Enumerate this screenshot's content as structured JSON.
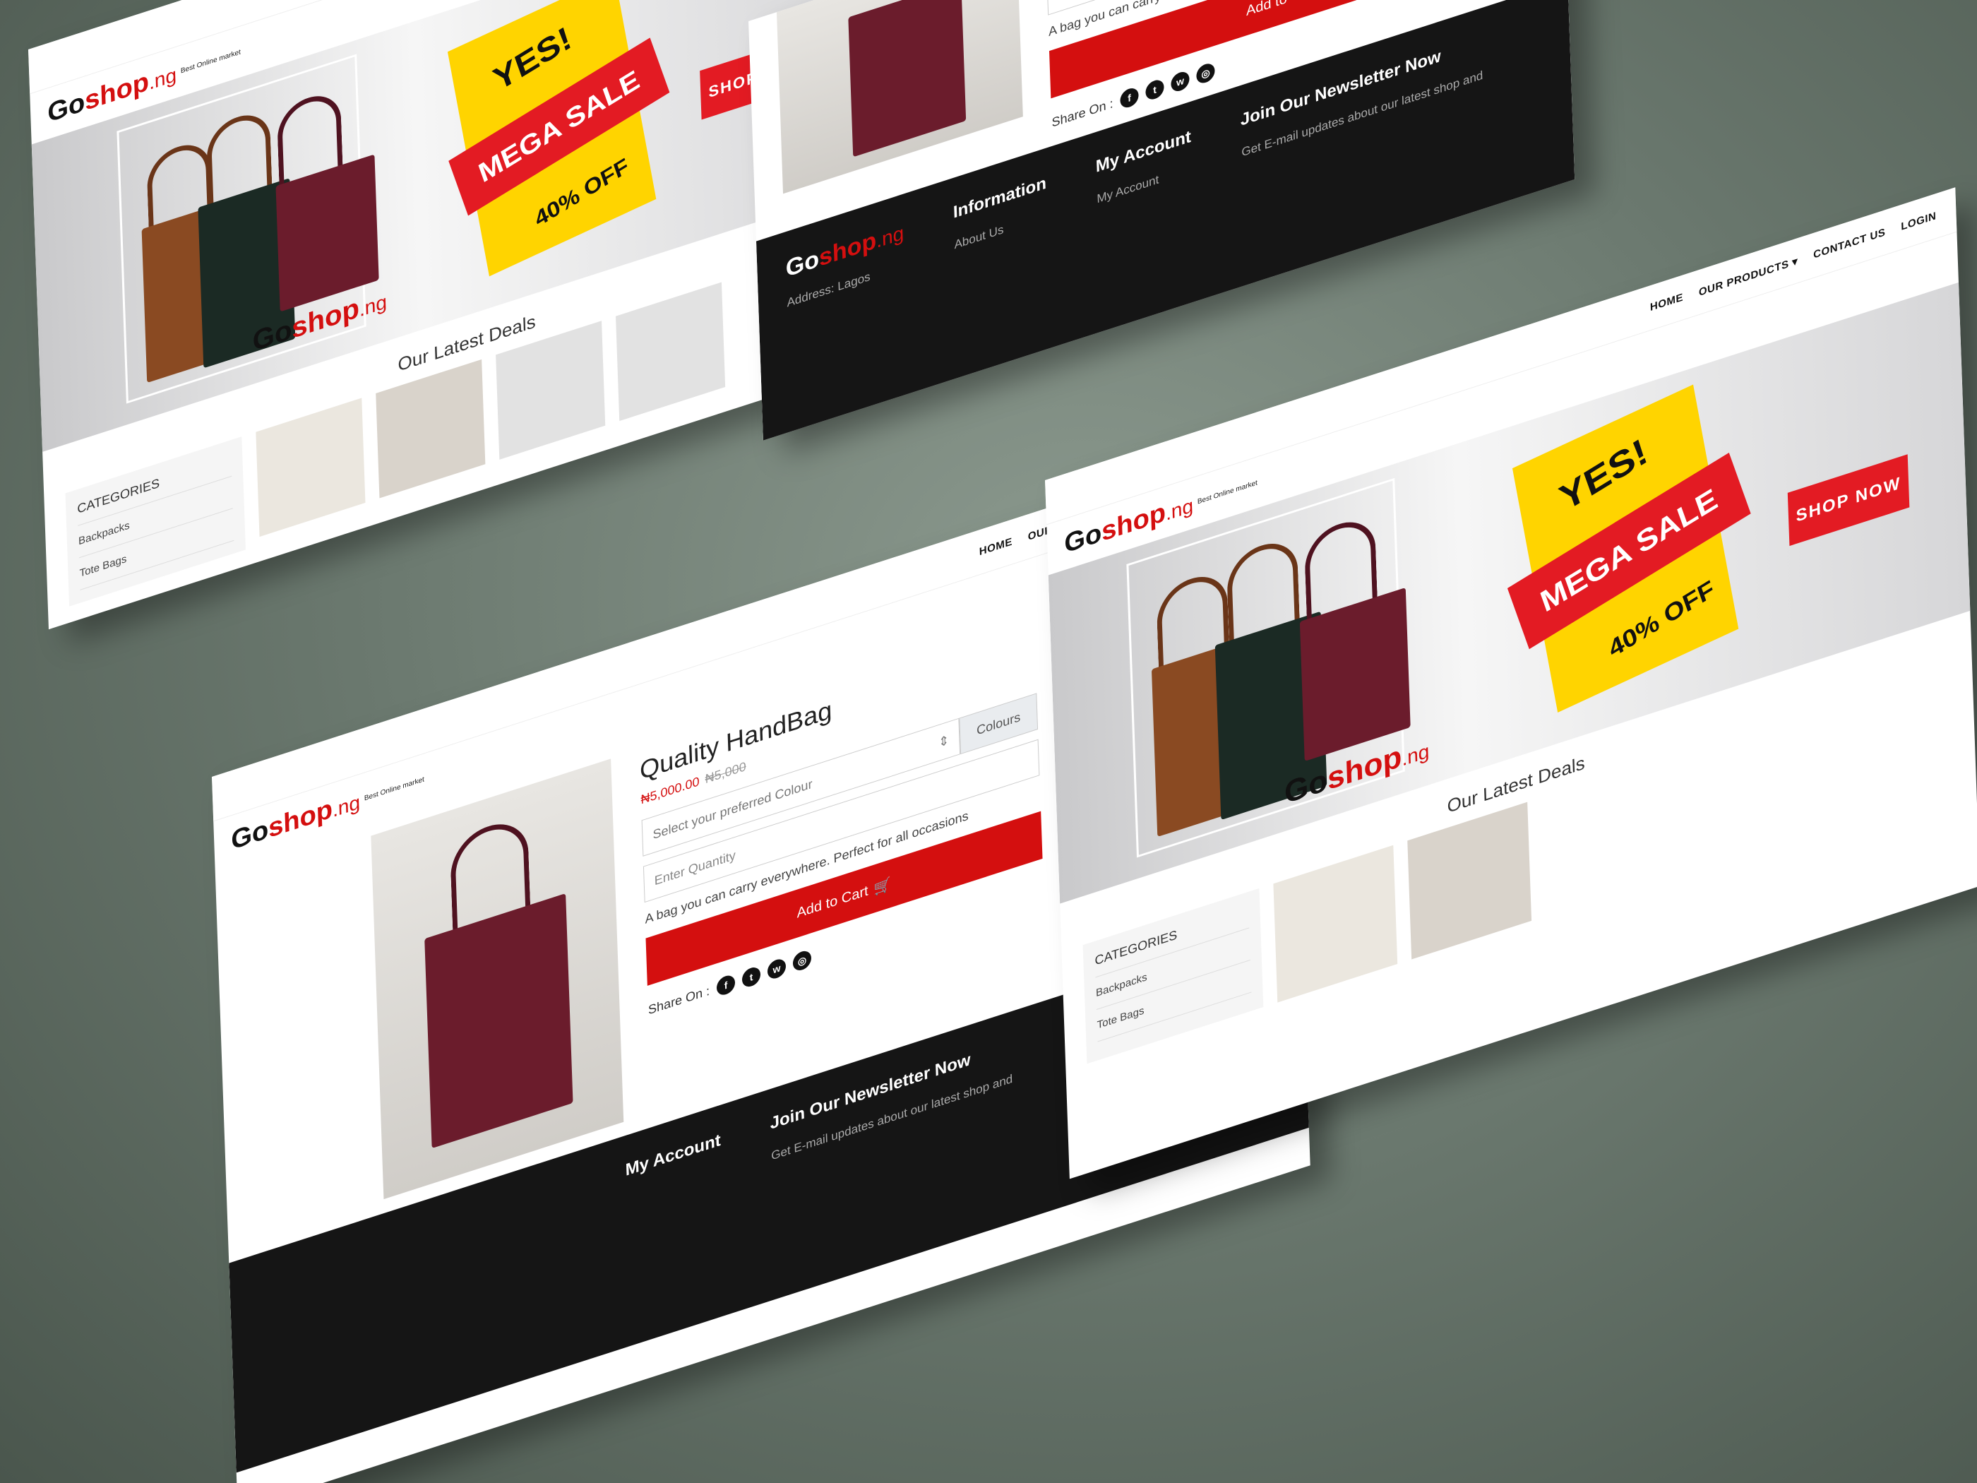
{
  "brand": {
    "go": "Go",
    "shop": "shop",
    "ng": ".ng",
    "tagline": "Best Online market"
  },
  "nav": {
    "home": "HOME",
    "products": "OUR PRODUCTS ▾",
    "contact": "CONTACT US",
    "login": "LOGIN"
  },
  "hero": {
    "yes": "YES!",
    "mega": "MEGA SALE",
    "off": "40% OFF",
    "cta": "SHOP NOW"
  },
  "home": {
    "deals_title": "Our Latest Deals",
    "categories_title": "CATEGORIES",
    "categories": [
      "Backpacks",
      "Tote Bags"
    ]
  },
  "product": {
    "title": "Quality HandBag",
    "price_now": "₦5,000.00",
    "price_was": "₦5,000",
    "colour_placeholder": "Select your preferred Colour",
    "colour_addon": "Colours",
    "qty_placeholder": "Enter Quantity",
    "description": "A bag you can carry everywhere. Perfect for all occasions",
    "add_to_cart": "Add to Cart",
    "share_label": "Share On :",
    "share_icons": [
      "facebook-icon",
      "twitter-icon",
      "whatsapp-icon",
      "instagram-icon"
    ]
  },
  "footer": {
    "information": "Information",
    "about": "About Us",
    "my_account": "My Account",
    "my_account_link": "My Account",
    "newsletter": "Join Our Newsletter Now",
    "newsletter_text": "Get E-mail updates about our latest shop and",
    "address": "Address: Lagos"
  },
  "colors": {
    "accent": "#d40f0f",
    "sale_yellow": "#ffd400",
    "footer_bg": "#151515"
  }
}
